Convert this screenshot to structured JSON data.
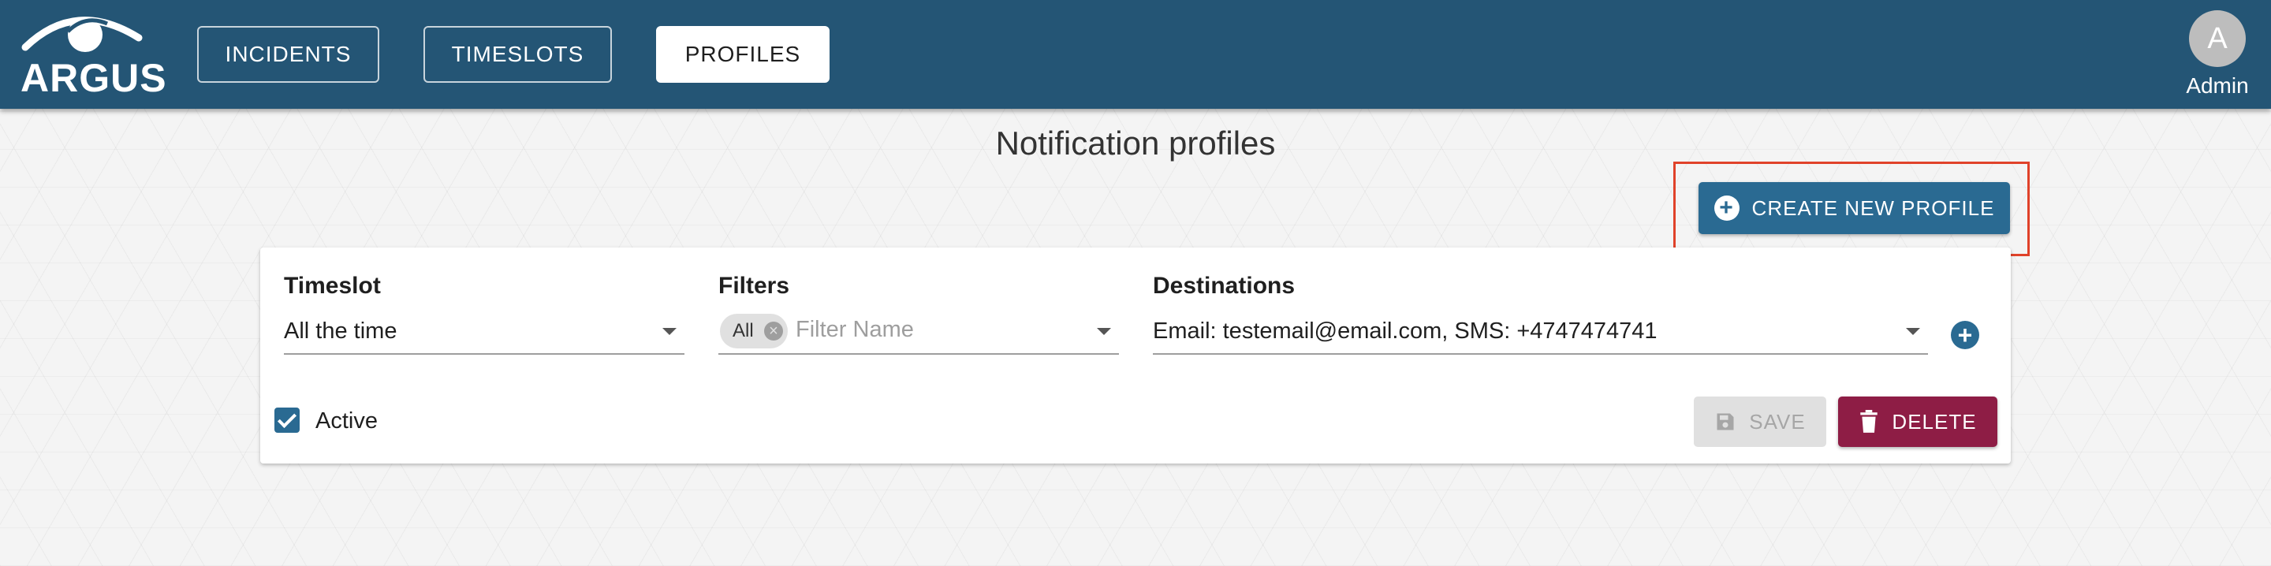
{
  "app": {
    "logo_text": "ARGUS",
    "logo_icon": "eye-icon"
  },
  "nav": {
    "items": [
      {
        "label": "INCIDENTS"
      },
      {
        "label": "TIMESLOTS"
      },
      {
        "label": "PROFILES",
        "active": true
      }
    ]
  },
  "user": {
    "initial": "A",
    "name": "Admin"
  },
  "page": {
    "title": "Notification profiles",
    "create_button_label": "CREATE NEW PROFILE",
    "create_button_icon": "add-circle-icon"
  },
  "profile": {
    "timeslot_label": "Timeslot",
    "timeslot_value": "All the time",
    "filters_label": "Filters",
    "filter_chip": "All",
    "filter_placeholder": "Filter Name",
    "destinations_label": "Destinations",
    "destinations_value": "Email: testemail@email.com, SMS: +4747474741",
    "active_label": "Active",
    "active_checked": true,
    "save_label": "SAVE",
    "save_icon": "save-icon",
    "delete_label": "DELETE",
    "delete_icon": "trash-icon"
  },
  "colors": {
    "header": "#245575",
    "primary": "#2a6a92",
    "delete": "#8e1d45",
    "highlight": "#e0422a"
  }
}
